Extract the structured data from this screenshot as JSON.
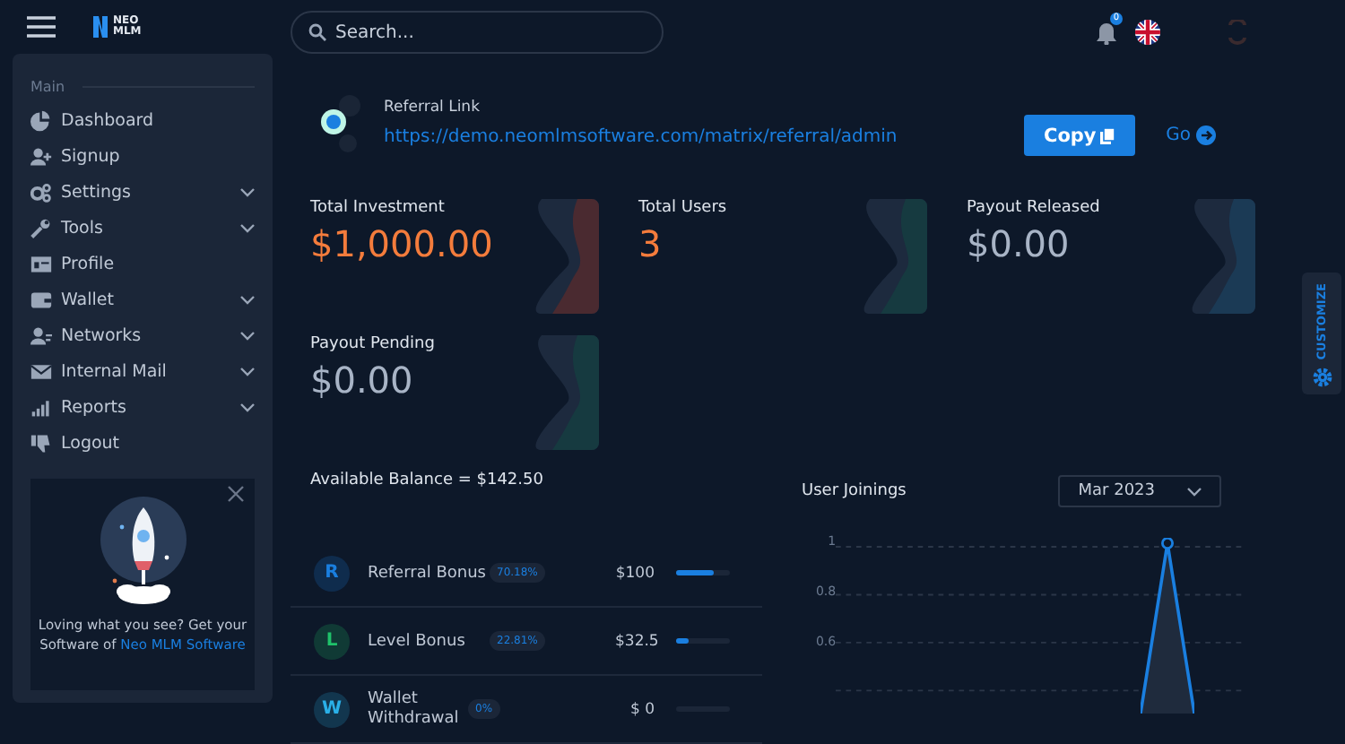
{
  "header": {
    "logo_text": "NEO MLM",
    "notification_count": "0",
    "search": {
      "placeholder": "Search..."
    }
  },
  "sidebar": {
    "section": "Main",
    "items": [
      {
        "label": "Dashboard",
        "kind": "pie",
        "expandable": false
      },
      {
        "label": "Signup",
        "kind": "signup",
        "expandable": false
      },
      {
        "label": "Settings",
        "kind": "settings",
        "expandable": true
      },
      {
        "label": "Tools",
        "kind": "tools",
        "expandable": true
      },
      {
        "label": "Profile",
        "kind": "profile",
        "expandable": false
      },
      {
        "label": "Wallet",
        "kind": "wallet",
        "expandable": true
      },
      {
        "label": "Networks",
        "kind": "network",
        "expandable": true
      },
      {
        "label": "Internal Mail",
        "kind": "mail",
        "expandable": true
      },
      {
        "label": "Reports",
        "kind": "reports",
        "expandable": true
      },
      {
        "label": "Logout",
        "kind": "logout",
        "expandable": false
      }
    ],
    "promo": {
      "text": "Loving what you see? Get your Software of ",
      "link": "Neo MLM Software"
    }
  },
  "referral": {
    "title": "Referral Link",
    "url": "https://demo.neomlmsoftware.com/matrix/referral/admin",
    "copy_button": "Copy",
    "go_link": "Go"
  },
  "stats": [
    {
      "label": "Total Investment",
      "value": "$1,000.00",
      "highlight": true,
      "color": "#4a2a30"
    },
    {
      "label": "Total Users",
      "value": "3",
      "highlight": true,
      "color": "#163a40"
    },
    {
      "label": "Payout Released",
      "value": "$0.00",
      "highlight": false,
      "color": "#1b3a55"
    },
    {
      "label": "Payout Pending",
      "value": "$0.00",
      "highlight": false,
      "color": "#163a40"
    }
  ],
  "balance": {
    "title": "Available Balance = $142.50",
    "rows": [
      {
        "letter": "R",
        "name": "Referral Bonus",
        "percent": "70.18%",
        "amount": "$100",
        "level": 0.7018,
        "color": "#1a7fe0"
      },
      {
        "letter": "L",
        "name": "Level Bonus",
        "percent": "22.81%",
        "amount": "$32.5",
        "level": 0.2281,
        "color": "#1fc26a"
      },
      {
        "letter": "W",
        "name": "Wallet Withdrawal",
        "percent": "0%",
        "amount": "$ 0",
        "level": 0,
        "color": "#2ab0e8"
      }
    ]
  },
  "joinings": {
    "title": "User Joinings",
    "month": "Mar 2023",
    "y_labels": [
      "1",
      "0.8",
      "0.6"
    ]
  },
  "customize": {
    "label": "CUSTOMIZE"
  }
}
